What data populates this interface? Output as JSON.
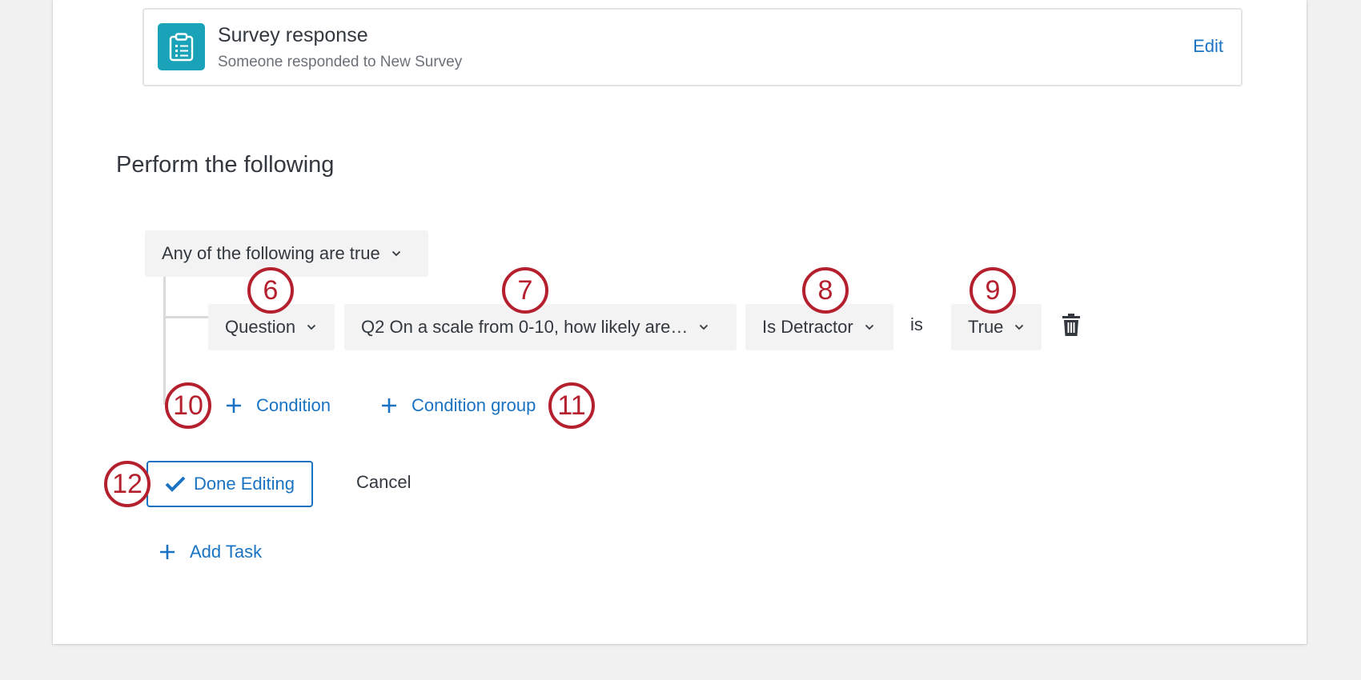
{
  "trigger": {
    "title": "Survey response",
    "subtitle": "Someone responded to New Survey",
    "edit_label": "Edit",
    "icon": "clipboard-list-icon",
    "icon_color": "#1aa3b8"
  },
  "section_title": "Perform the following",
  "logic_dropdown": {
    "label": "Any of the following are true"
  },
  "condition": {
    "type_label": "Question",
    "question_label": "Q2 On a scale from 0-10, how likely are…",
    "metric_label": "Is Detractor",
    "operator_label": "is",
    "value_label": "True"
  },
  "actions": {
    "add_condition": "Condition",
    "add_condition_group": "Condition group",
    "done_editing": "Done Editing",
    "cancel": "Cancel",
    "add_task": "Add Task"
  },
  "callouts": [
    "6",
    "7",
    "8",
    "9",
    "10",
    "11",
    "12"
  ],
  "colors": {
    "link": "#1a73c2",
    "callout": "#b5202e",
    "dropdown_bg": "#f3f3f3"
  }
}
